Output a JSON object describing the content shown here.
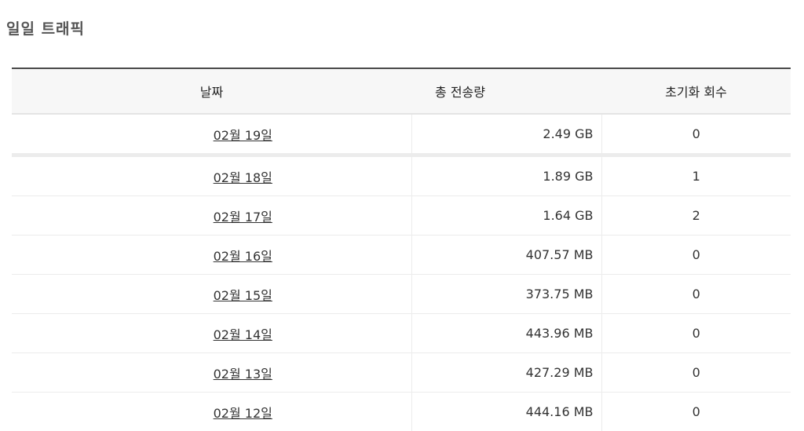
{
  "section": {
    "title": "일일 트래픽"
  },
  "table": {
    "headers": {
      "date": "날짜",
      "total": "총 전송량",
      "reset": "초기화 회수"
    },
    "rows": [
      {
        "date": "02월 19일",
        "total": "2.49 GB",
        "reset": "0"
      },
      {
        "date": "02월 18일",
        "total": "1.89 GB",
        "reset": "1"
      },
      {
        "date": "02월 17일",
        "total": "1.64 GB",
        "reset": "2"
      },
      {
        "date": "02월 16일",
        "total": "407.57 MB",
        "reset": "0"
      },
      {
        "date": "02월 15일",
        "total": "373.75 MB",
        "reset": "0"
      },
      {
        "date": "02월 14일",
        "total": "443.96 MB",
        "reset": "0"
      },
      {
        "date": "02월 13일",
        "total": "427.29 MB",
        "reset": "0"
      },
      {
        "date": "02월 12일",
        "total": "444.16 MB",
        "reset": "0"
      }
    ]
  }
}
